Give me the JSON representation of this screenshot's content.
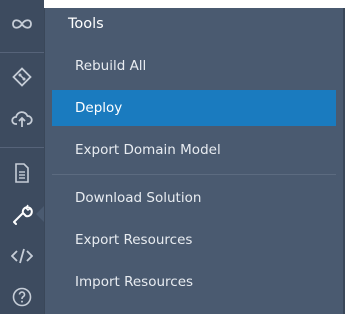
{
  "rail": {
    "icons": [
      {
        "name": "infinity-icon"
      },
      {
        "name": "git-icon"
      },
      {
        "name": "cloud-upload-icon"
      },
      {
        "name": "document-icon"
      },
      {
        "name": "wrench-icon",
        "active": true
      },
      {
        "name": "code-icon"
      },
      {
        "name": "help-icon"
      }
    ]
  },
  "menu": {
    "title": "Tools",
    "items": [
      {
        "label": "Rebuild All"
      },
      {
        "label": "Deploy",
        "selected": true
      },
      {
        "label": "Export Domain Model"
      },
      {
        "label": "Download Solution"
      },
      {
        "label": "Export Resources"
      },
      {
        "label": "Import Resources"
      }
    ]
  },
  "colors": {
    "rail_bg": "#3d4b5f",
    "menu_bg": "#4a5a70",
    "selected_bg": "#1a7bbf",
    "icon": "#c6cdd7"
  }
}
